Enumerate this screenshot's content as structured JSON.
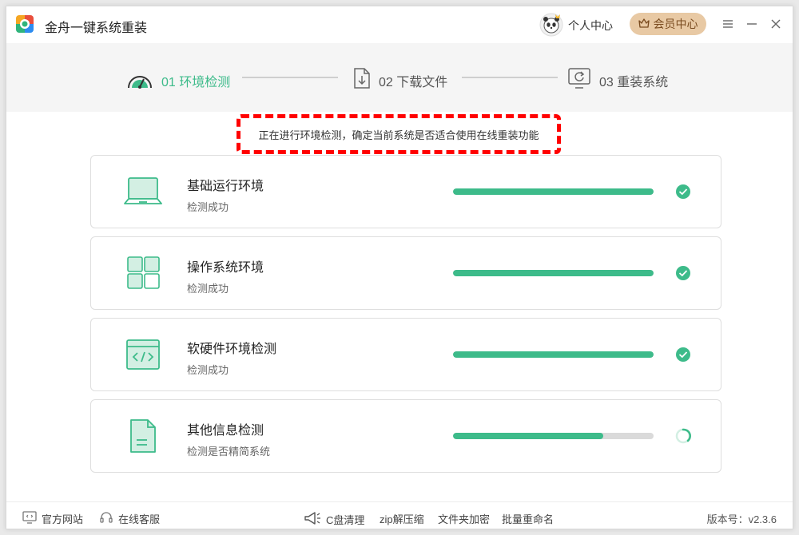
{
  "app": {
    "title": "金舟一键系统重装"
  },
  "header": {
    "user_center": "个人中心",
    "vip_label": "会员中心"
  },
  "steps": [
    {
      "label": "01 环境检测",
      "icon": "gauge-icon",
      "active": true
    },
    {
      "label": "02 下载文件",
      "icon": "download-icon",
      "active": false
    },
    {
      "label": "03 重装系统",
      "icon": "reinstall-icon",
      "active": false
    }
  ],
  "notice": "正在进行环境检测，确定当前系统是否适合使用在线重装功能",
  "checks": [
    {
      "title": "基础运行环境",
      "status": "检测成功",
      "progress": 1.0,
      "state": "done",
      "icon": "laptop-icon"
    },
    {
      "title": "操作系统环境",
      "status": "检测成功",
      "progress": 1.0,
      "state": "done",
      "icon": "windows-grid-icon"
    },
    {
      "title": "软硬件环境检测",
      "status": "检测成功",
      "progress": 1.0,
      "state": "done",
      "icon": "code-window-icon"
    },
    {
      "title": "其他信息检测",
      "status": "检测是否精简系统",
      "progress": 0.75,
      "state": "loading",
      "icon": "document-icon"
    }
  ],
  "footer": {
    "links": [
      "官方网站",
      "在线客服"
    ],
    "tools": [
      "C盘清理",
      "zip解压缩",
      "文件夹加密",
      "批量重命名"
    ],
    "version": "版本号：v2.3.6"
  },
  "colors": {
    "accent": "#3dbb8a",
    "notice_border": "#ff0000",
    "vip_bg": "#e8c9a4"
  }
}
